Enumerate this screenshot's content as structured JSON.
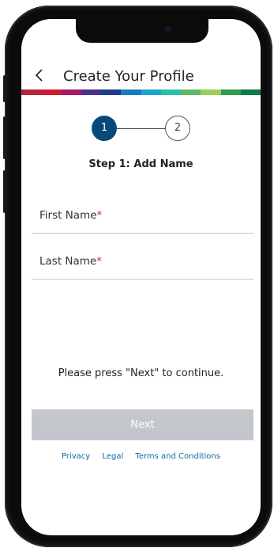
{
  "header": {
    "back_icon": "chevron-left-icon",
    "title": "Create Your Profile"
  },
  "color_bar": [
    "#b5243b",
    "#d0192e",
    "#a9186a",
    "#4a2f8f",
    "#1e3d8f",
    "#157bbf",
    "#1aa3cc",
    "#2bbfa8",
    "#5fb96a",
    "#9ccf5a",
    "#2e9a4f",
    "#0d7d44"
  ],
  "stepper": {
    "steps": [
      "1",
      "2"
    ],
    "active_step": 1,
    "active_color": "#074a7a",
    "label": "Step 1: Add Name"
  },
  "form": {
    "first_name": {
      "label": "First Name",
      "required_mark": "*",
      "value": ""
    },
    "last_name": {
      "label": "Last Name",
      "required_mark": "*",
      "value": ""
    }
  },
  "info_text": "Please press \"Next\" to continue.",
  "next_button": {
    "label": "Next",
    "enabled": false,
    "color": "#c3c7cb"
  },
  "footer": {
    "privacy": "Privacy",
    "legal": "Legal",
    "terms": "Terms and Conditions",
    "link_color": "#0d6aa3"
  }
}
